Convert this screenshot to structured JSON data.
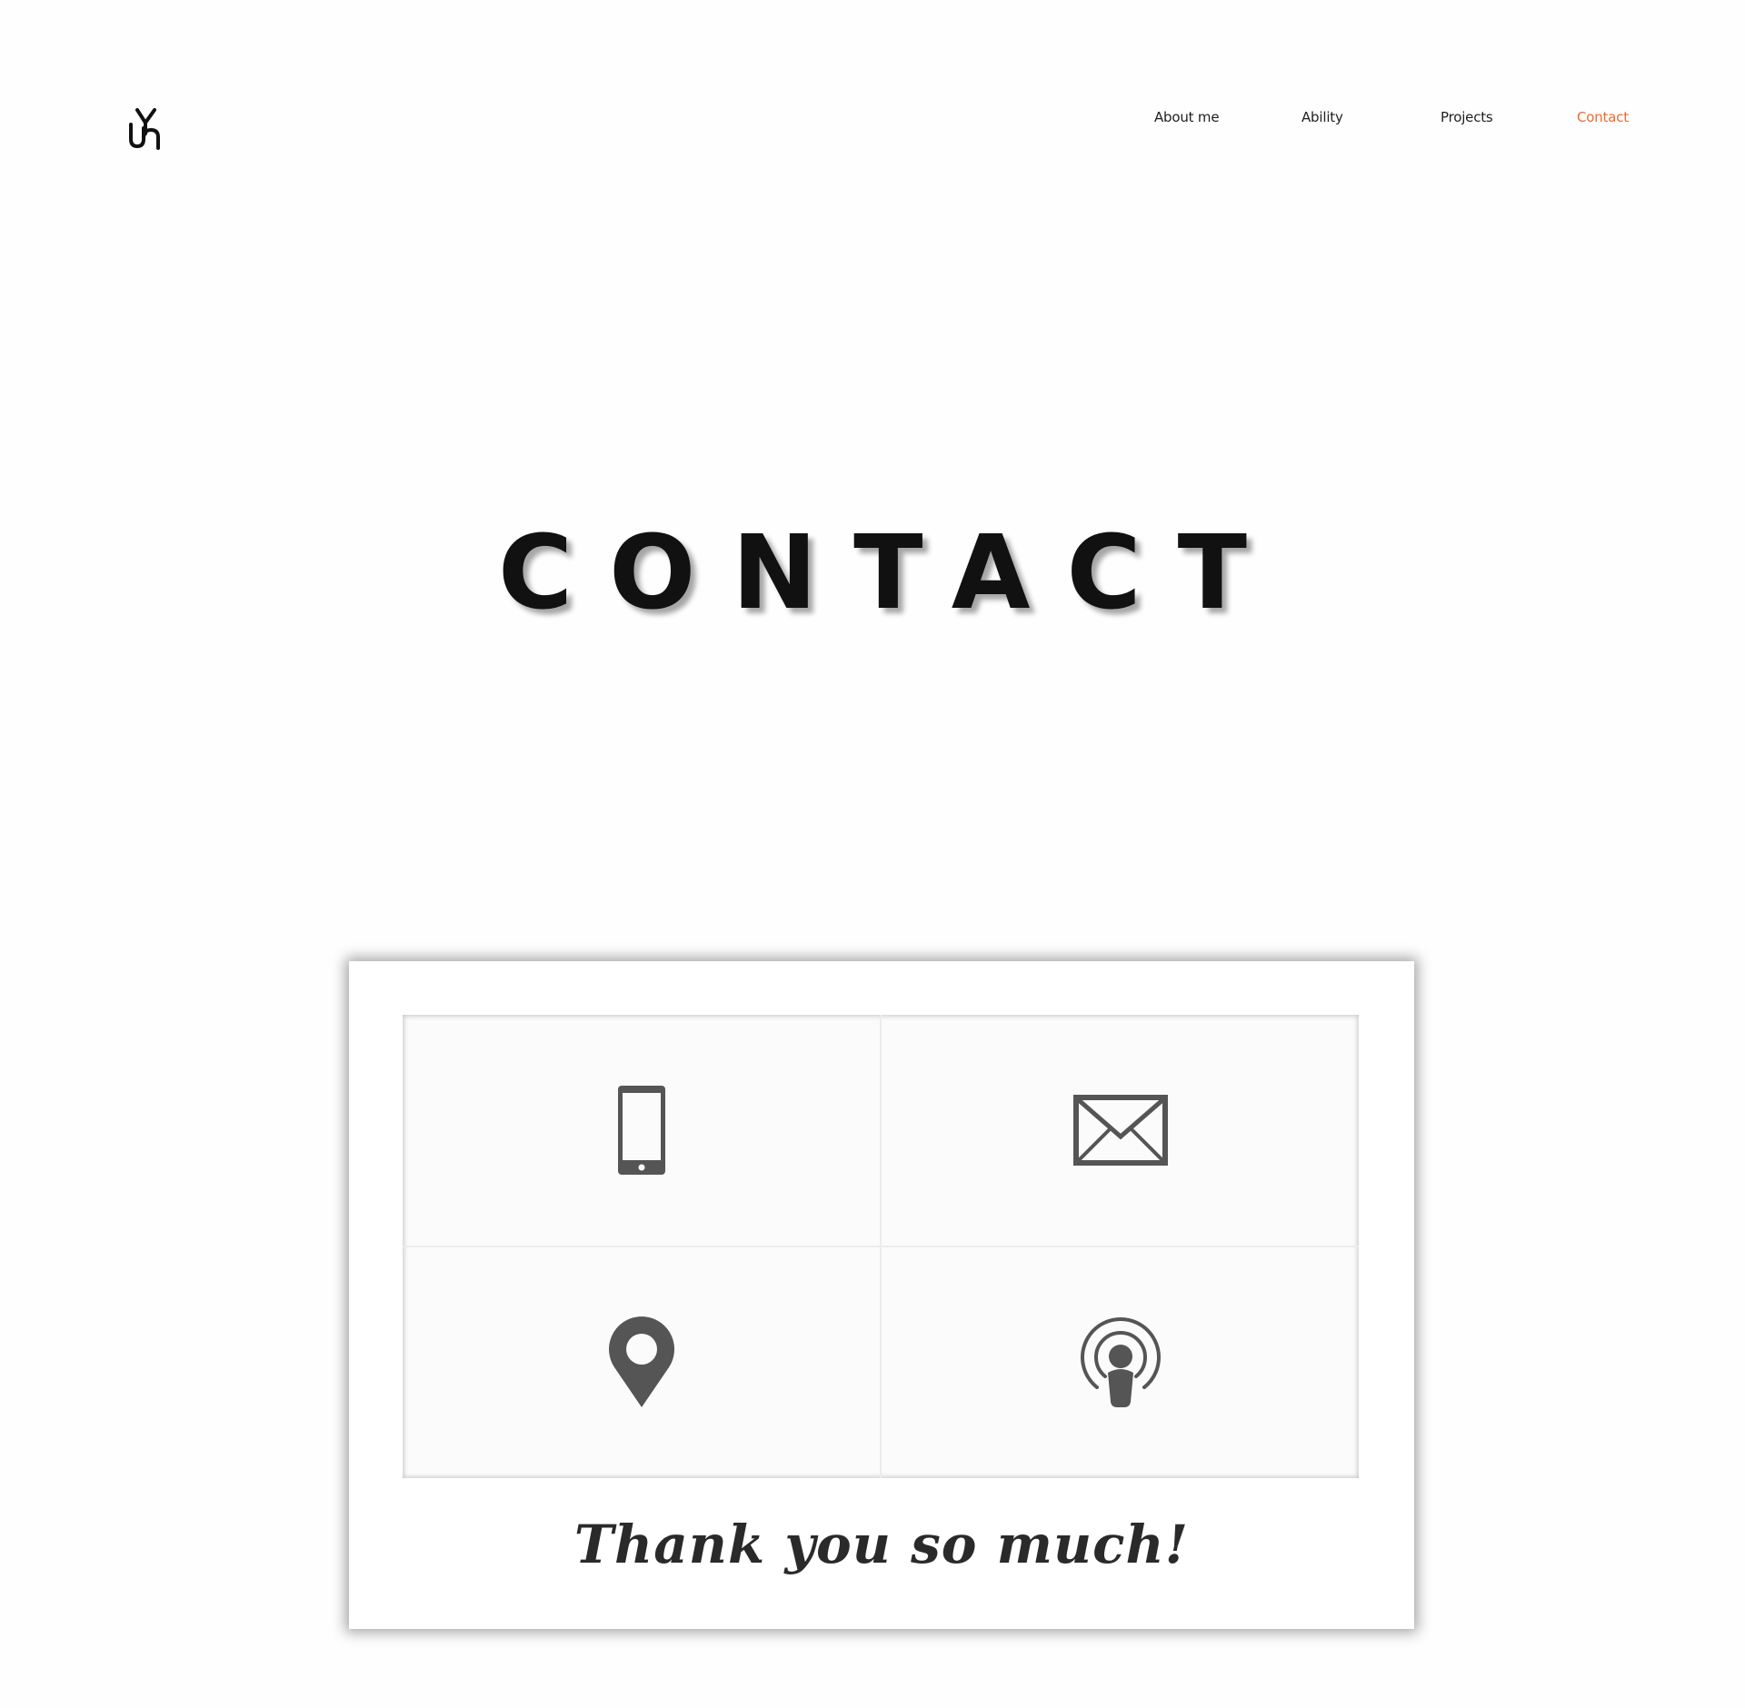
{
  "header": {
    "logo_alt": "logo"
  },
  "nav": {
    "items": [
      {
        "label": "About me"
      },
      {
        "label": "Ability"
      },
      {
        "label": "Projects"
      },
      {
        "label": "Contact",
        "active": true
      }
    ],
    "active_color": "#ed6a2c"
  },
  "hero": {
    "title": "CONTACT"
  },
  "contact_card": {
    "cells": [
      {
        "icon": "phone-icon"
      },
      {
        "icon": "mail-icon"
      },
      {
        "icon": "location-pin-icon"
      },
      {
        "icon": "podcast-icon"
      }
    ],
    "icon_color": "#555555",
    "thanks": "Thank you so much!"
  }
}
